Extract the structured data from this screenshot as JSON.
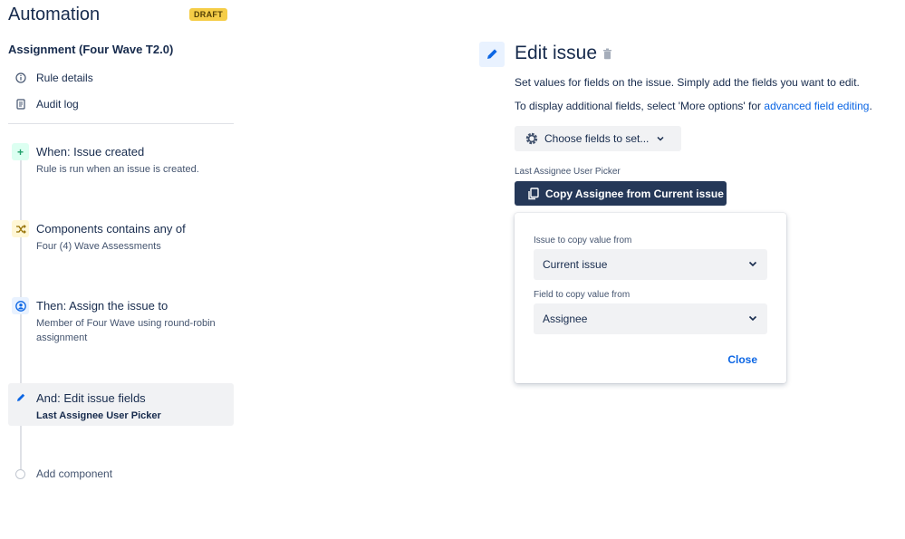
{
  "header": {
    "title": "Automation",
    "badge": "DRAFT"
  },
  "rule": {
    "name": "Assignment (Four Wave T2.0)"
  },
  "sidebar_links": {
    "rule_details": "Rule details",
    "audit_log": "Audit log"
  },
  "steps": {
    "when": {
      "title": "When: Issue created",
      "desc": "Rule is run when an issue is created."
    },
    "condition": {
      "title": "Components contains any of",
      "desc": "Four (4) Wave Assessments"
    },
    "then": {
      "title": "Then: Assign the issue to",
      "desc": "Member of Four Wave using round-robin assignment"
    },
    "and": {
      "title": "And: Edit issue fields",
      "desc": "Last Assignee User Picker"
    },
    "add": "Add component"
  },
  "panel": {
    "title": "Edit issue",
    "text1": "Set values for fields on the issue. Simply add the fields you want to edit.",
    "text2_prefix": "To display additional fields, select 'More options' for ",
    "text2_link": "advanced field editing",
    "text2_suffix": ".",
    "choose_fields": "Choose fields to set...",
    "field_label": "Last Assignee User Picker",
    "copy_button": "Copy Assignee from Current issue"
  },
  "popup": {
    "issue_label": "Issue to copy value from",
    "issue_value": "Current issue",
    "field_label": "Field to copy value from",
    "field_value": "Assignee",
    "close": "Close"
  },
  "colors": {
    "accent": "#0c66e4",
    "copy_button_bg": "#253858",
    "draft_badge": "#f5cd47",
    "trigger_green": "#22a06b"
  },
  "icons": {
    "rule_details": "info-icon",
    "audit_log": "document-icon",
    "when": "plus-icon",
    "condition": "shuffle-icon",
    "then": "user-icon",
    "and": "pencil-icon",
    "panel": "pencil-icon",
    "trash": "trash-icon",
    "gear": "gear-icon",
    "copy": "copy-icon",
    "chevron": "chevron-down-icon"
  }
}
